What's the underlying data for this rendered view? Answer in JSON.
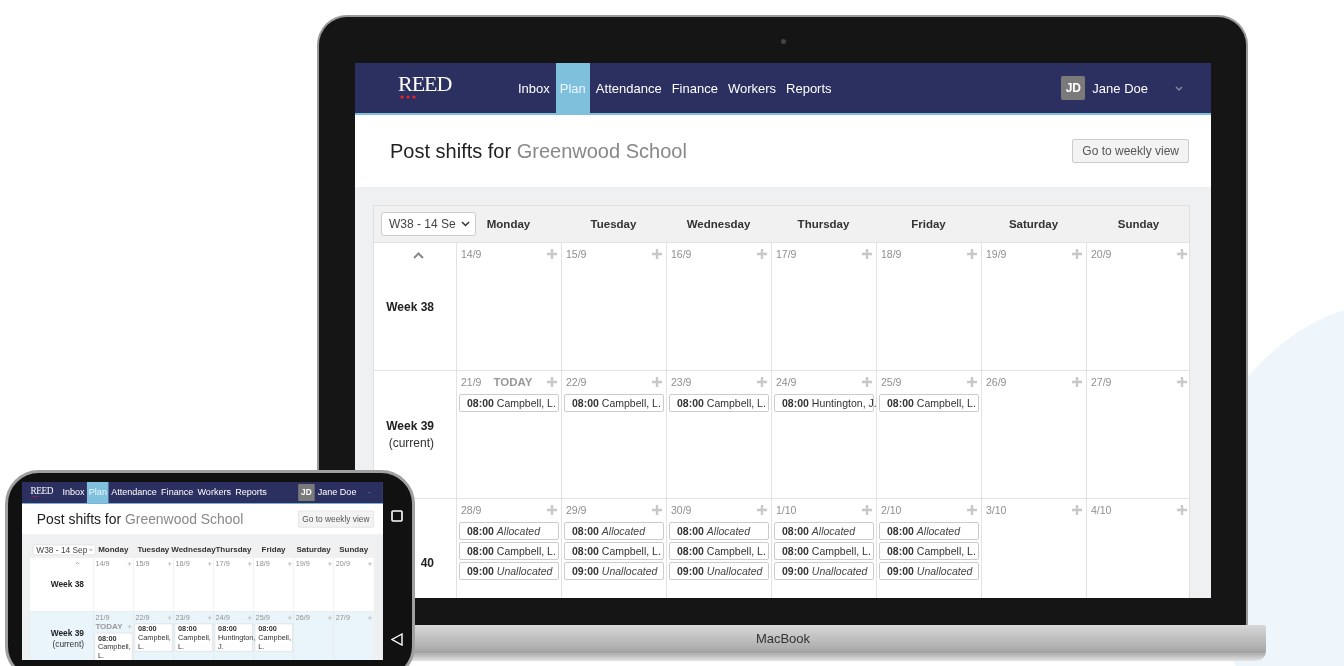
{
  "laptop": {
    "label": "MacBook",
    "screen": {
      "logo": "REED",
      "nav": [
        {
          "label": "Inbox",
          "selected": false
        },
        {
          "label": "Plan",
          "selected": true
        },
        {
          "label": "Attendance",
          "selected": false
        },
        {
          "label": "Finance",
          "selected": false
        },
        {
          "label": "Workers",
          "selected": false
        },
        {
          "label": "Reports",
          "selected": false
        }
      ],
      "user": {
        "initials": "JD",
        "name": "Jane Doe"
      },
      "page_title": {
        "prefix": "Post shifts for",
        "school": "Greenwood School"
      },
      "weekly_button": "Go to weekly view",
      "week_select": "W38 - 14 Se",
      "days": [
        "Monday",
        "Tuesday",
        "Wednesday",
        "Thursday",
        "Friday",
        "Saturday",
        "Sunday"
      ],
      "weeks": [
        {
          "label": "Week 38",
          "collapse_arrow": true,
          "highlighted": false,
          "days": [
            {
              "date": "14/9"
            },
            {
              "date": "15/9"
            },
            {
              "date": "16/9"
            },
            {
              "date": "17/9"
            },
            {
              "date": "18/9"
            },
            {
              "date": "19/9"
            },
            {
              "date": "20/9"
            }
          ]
        },
        {
          "label": "Week 39",
          "note": "(current)",
          "collapse_arrow": false,
          "highlighted": false,
          "days": [
            {
              "date": "21/9",
              "today": "TODAY",
              "shifts": [
                {
                  "time": "08:00",
                  "name": "Campbell, L.",
                  "kind": "worker"
                }
              ]
            },
            {
              "date": "22/9",
              "shifts": [
                {
                  "time": "08:00",
                  "name": "Campbell, L.",
                  "kind": "worker"
                }
              ]
            },
            {
              "date": "23/9",
              "shifts": [
                {
                  "time": "08:00",
                  "name": "Campbell, L.",
                  "kind": "worker"
                }
              ]
            },
            {
              "date": "24/9",
              "shifts": [
                {
                  "time": "08:00",
                  "name": "Huntington, J.",
                  "kind": "worker"
                }
              ]
            },
            {
              "date": "25/9",
              "shifts": [
                {
                  "time": "08:00",
                  "name": "Campbell, L.",
                  "kind": "worker"
                }
              ]
            },
            {
              "date": "26/9"
            },
            {
              "date": "27/9"
            }
          ]
        },
        {
          "label": "40",
          "collapse_arrow": false,
          "highlighted": false,
          "days": [
            {
              "date": "28/9",
              "shifts": [
                {
                  "time": "08:00",
                  "name": "Allocated",
                  "kind": "status"
                },
                {
                  "time": "08:00",
                  "name": "Campbell, L.",
                  "kind": "worker"
                },
                {
                  "time": "09:00",
                  "name": "Unallocated",
                  "kind": "status"
                }
              ]
            },
            {
              "date": "29/9",
              "shifts": [
                {
                  "time": "08:00",
                  "name": "Allocated",
                  "kind": "status"
                },
                {
                  "time": "08:00",
                  "name": "Campbell, L.",
                  "kind": "worker"
                },
                {
                  "time": "09:00",
                  "name": "Unallocated",
                  "kind": "status"
                }
              ]
            },
            {
              "date": "30/9",
              "shifts": [
                {
                  "time": "08:00",
                  "name": "Allocated",
                  "kind": "status"
                },
                {
                  "time": "08:00",
                  "name": "Campbell, L.",
                  "kind": "worker"
                },
                {
                  "time": "09:00",
                  "name": "Unallocated",
                  "kind": "status"
                }
              ]
            },
            {
              "date": "1/10",
              "shifts": [
                {
                  "time": "08:00",
                  "name": "Allocated",
                  "kind": "status"
                },
                {
                  "time": "08:00",
                  "name": "Campbell, L.",
                  "kind": "worker"
                },
                {
                  "time": "09:00",
                  "name": "Unallocated",
                  "kind": "status"
                }
              ]
            },
            {
              "date": "2/10",
              "shifts": [
                {
                  "time": "08:00",
                  "name": "Allocated",
                  "kind": "status"
                },
                {
                  "time": "08:00",
                  "name": "Campbell, L.",
                  "kind": "worker"
                },
                {
                  "time": "09:00",
                  "name": "Unallocated",
                  "kind": "status"
                }
              ]
            },
            {
              "date": "3/10"
            },
            {
              "date": "4/10"
            }
          ]
        }
      ]
    }
  },
  "phone": {
    "screen": {
      "logo": "REED",
      "nav": [
        {
          "label": "Inbox",
          "selected": false
        },
        {
          "label": "Plan",
          "selected": true
        },
        {
          "label": "Attendance",
          "selected": false
        },
        {
          "label": "Finance",
          "selected": false
        },
        {
          "label": "Workers",
          "selected": false
        },
        {
          "label": "Reports",
          "selected": false
        }
      ],
      "user": {
        "initials": "JD",
        "name": "Jane Doe"
      },
      "page_title": {
        "prefix": "Post shifts for",
        "school": "Greenwood School"
      },
      "weekly_button": "Go to weekly view",
      "week_select": "W38 - 14 Sep",
      "days": [
        "Monday",
        "Tuesday",
        "Wednesday",
        "Thursday",
        "Friday",
        "Saturday",
        "Sunday"
      ],
      "weeks": [
        {
          "label": "Week 38",
          "collapse_arrow": true,
          "highlighted": false,
          "days": [
            {
              "date": "14/9"
            },
            {
              "date": "15/9"
            },
            {
              "date": "16/9"
            },
            {
              "date": "17/9"
            },
            {
              "date": "18/9"
            },
            {
              "date": "19/9"
            },
            {
              "date": "20/9"
            }
          ]
        },
        {
          "label": "Week 39",
          "note": "(current)",
          "collapse_arrow": false,
          "highlighted": true,
          "days": [
            {
              "date": "21/9",
              "today": "TODAY",
              "shifts": [
                {
                  "time": "08:00",
                  "name": "Campbell, L.",
                  "kind": "worker"
                }
              ]
            },
            {
              "date": "22/9",
              "shifts": [
                {
                  "time": "08:00",
                  "name": "Campbell, L.",
                  "kind": "worker"
                }
              ]
            },
            {
              "date": "23/9",
              "shifts": [
                {
                  "time": "08:00",
                  "name": "Campbell, L.",
                  "kind": "worker"
                }
              ]
            },
            {
              "date": "24/9",
              "shifts": [
                {
                  "time": "08:00",
                  "name": "Huntington, J.",
                  "kind": "worker"
                }
              ]
            },
            {
              "date": "25/9",
              "shifts": [
                {
                  "time": "08:00",
                  "name": "Campbell, L.",
                  "kind": "worker"
                }
              ]
            },
            {
              "date": "26/9"
            },
            {
              "date": "27/9"
            }
          ]
        }
      ]
    }
  }
}
